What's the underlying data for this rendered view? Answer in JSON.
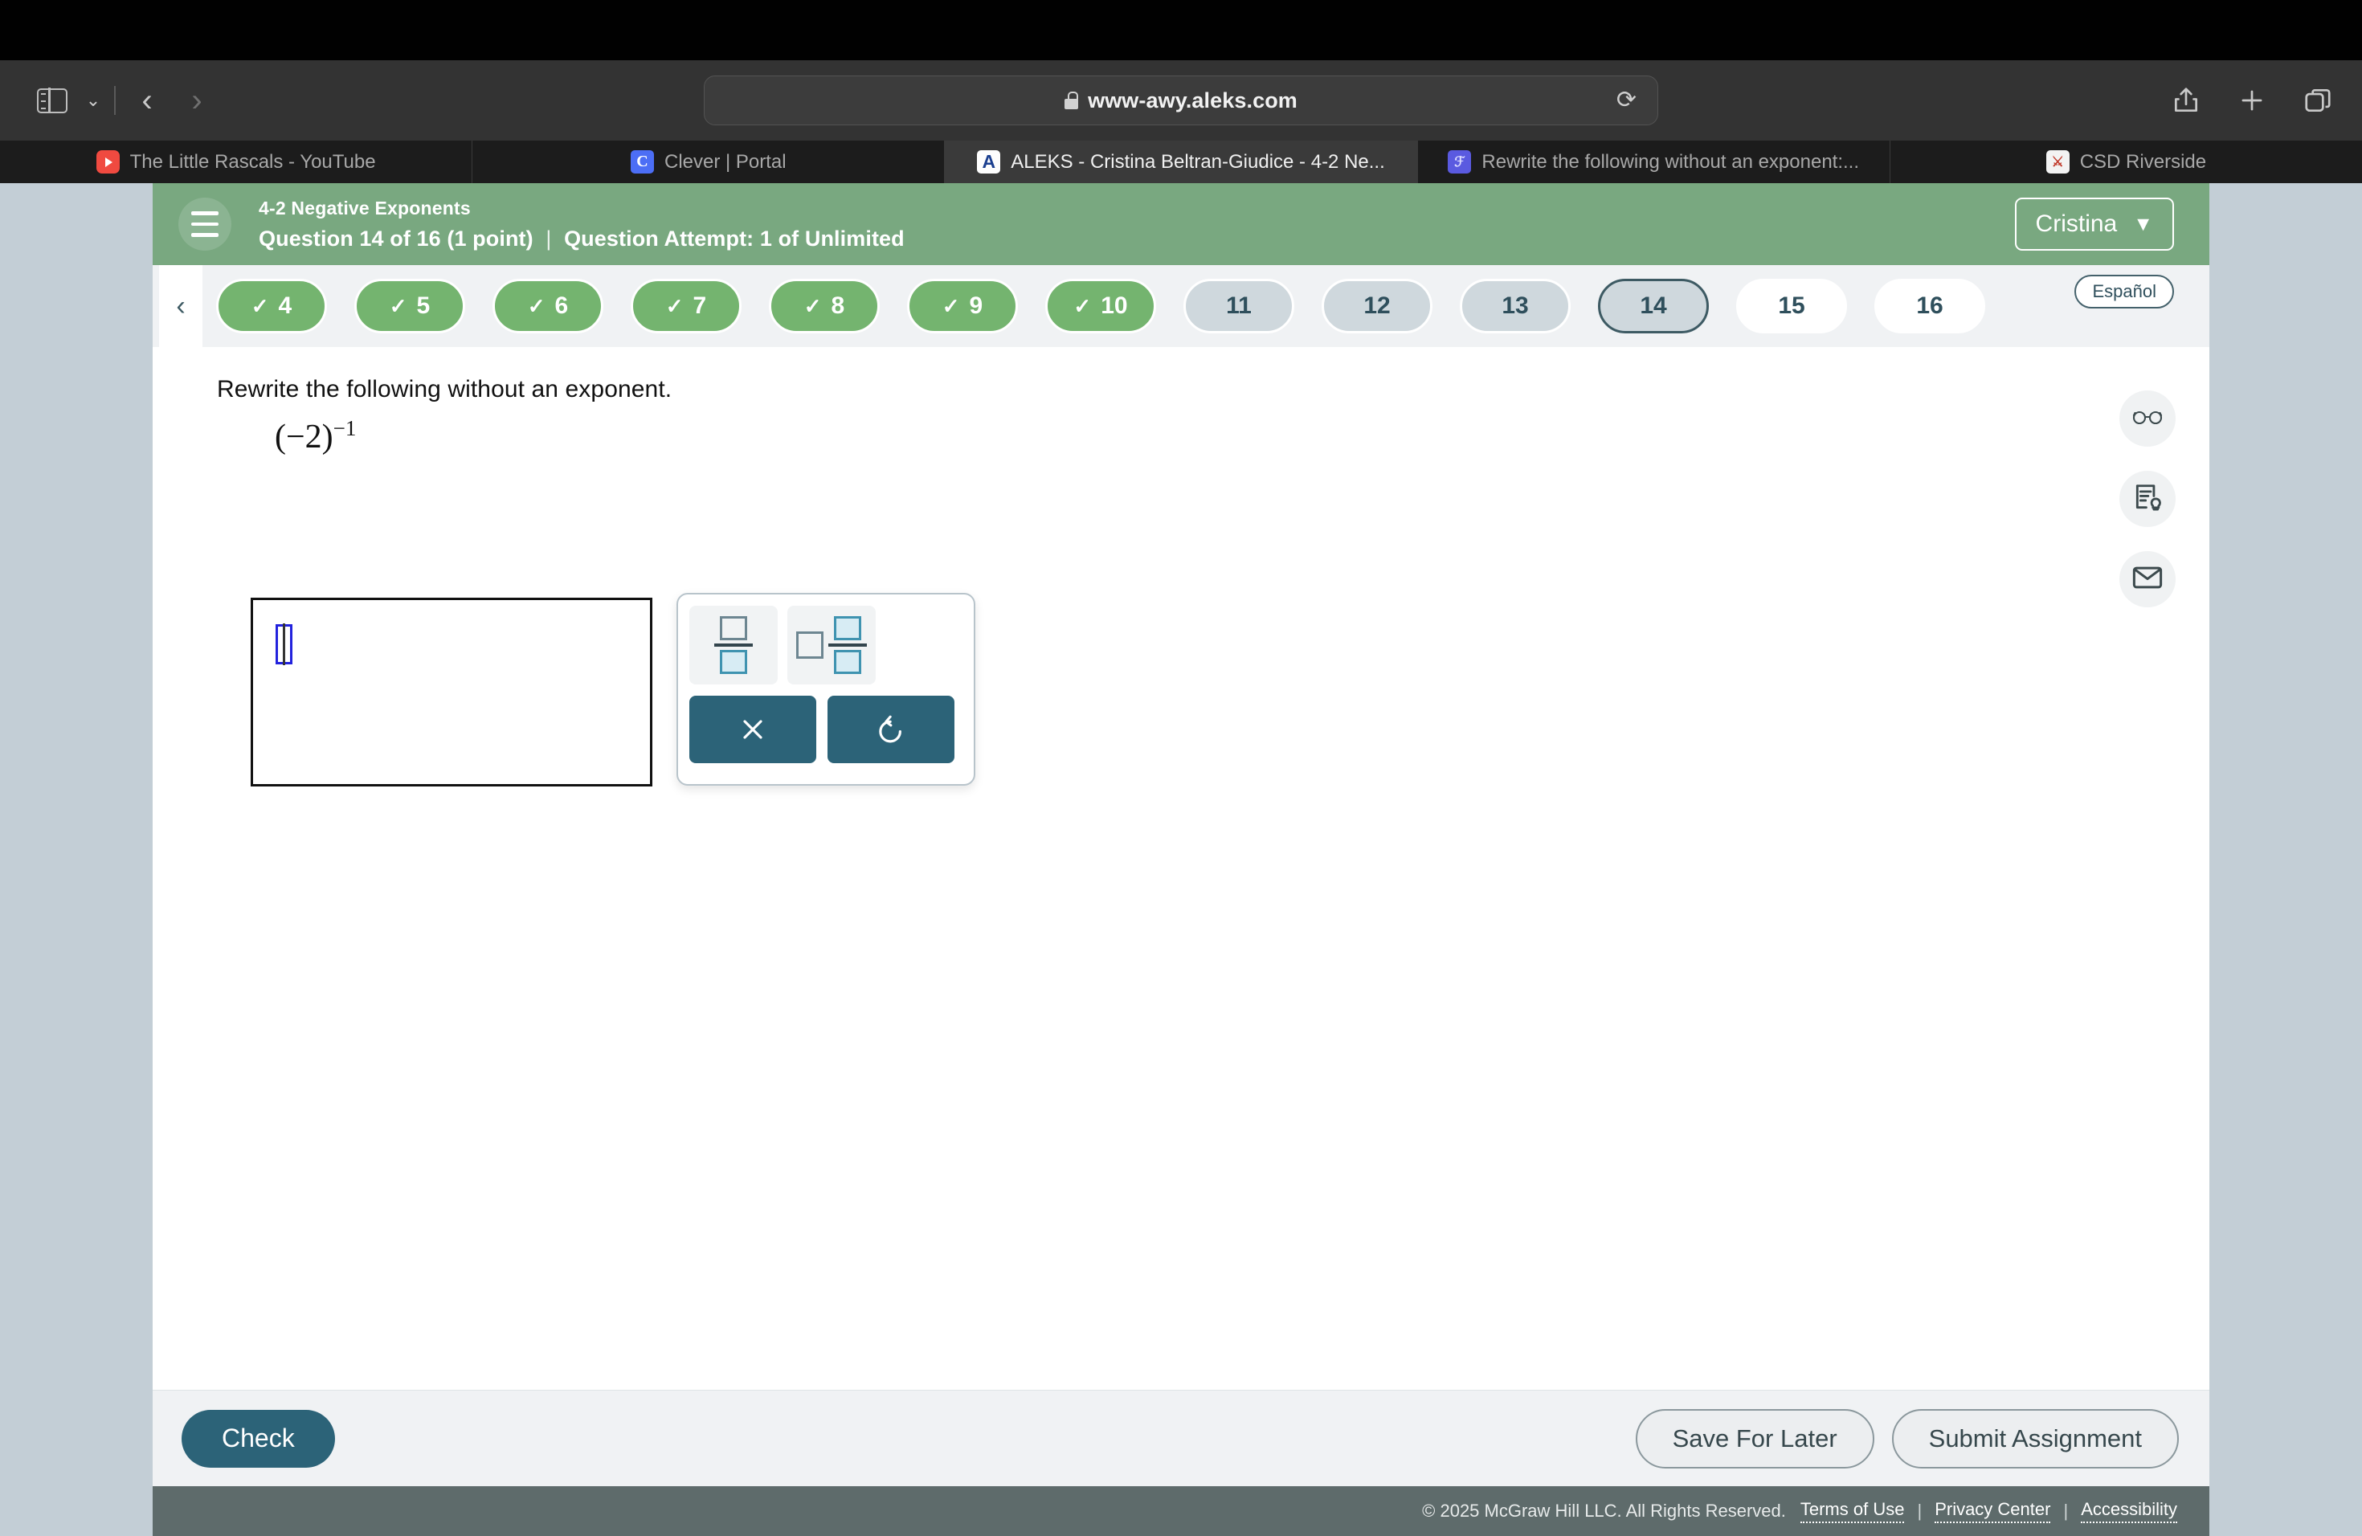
{
  "browser": {
    "url": "www-awy.aleks.com",
    "url_secure_icon": "lock-icon",
    "reload_icon": "reload-icon",
    "sidebar_icon": "sidebar-toggle-icon",
    "back_icon": "back-chevron-icon",
    "forward_icon": "forward-chevron-icon",
    "share_icon": "share-icon",
    "new_tab_icon": "plus-icon",
    "tabs_overview_icon": "tab-overview-icon",
    "tabs": [
      {
        "title": "The Little Rascals - YouTube",
        "favicon": "youtube-icon",
        "favicon_letter": "",
        "active": false
      },
      {
        "title": "Clever | Portal",
        "favicon": "clever-icon",
        "favicon_letter": "C",
        "active": false
      },
      {
        "title": "ALEKS - Cristina Beltran-Giudice - 4-2 Ne...",
        "favicon": "aleks-icon",
        "favicon_letter": "A",
        "active": true
      },
      {
        "title": "Rewrite the following without an exponent:...",
        "favicon": "doc-icon",
        "favicon_letter": "ℱ",
        "active": false
      },
      {
        "title": "CSD Riverside",
        "favicon": "csd-riverside-icon",
        "favicon_letter": "⚔",
        "active": false
      }
    ]
  },
  "header": {
    "menu_icon": "hamburger-menu-icon",
    "assignment_title": "4-2 Negative Exponents",
    "question_counter": "Question 14 of 16 (1 point)",
    "separator": "|",
    "attempt_text": "Question Attempt: 1 of Unlimited",
    "user_name": "Cristina",
    "user_caret_icon": "chevron-down-icon",
    "brand_green": "#79a880"
  },
  "qnav": {
    "back_icon": "chevron-left-icon",
    "espanol_label": "Español",
    "check_glyph": "✓",
    "items": [
      {
        "number": "4",
        "state": "done"
      },
      {
        "number": "5",
        "state": "done"
      },
      {
        "number": "6",
        "state": "done"
      },
      {
        "number": "7",
        "state": "done"
      },
      {
        "number": "8",
        "state": "done"
      },
      {
        "number": "9",
        "state": "done"
      },
      {
        "number": "10",
        "state": "done"
      },
      {
        "number": "11",
        "state": "pending"
      },
      {
        "number": "12",
        "state": "pending"
      },
      {
        "number": "13",
        "state": "pending"
      },
      {
        "number": "14",
        "state": "current"
      },
      {
        "number": "15",
        "state": "future"
      },
      {
        "number": "16",
        "state": "future"
      }
    ],
    "colors": {
      "done": "#74b46f",
      "pending": "#cfd8dd",
      "current_border": "#3d5a63",
      "future": "#ffffff"
    }
  },
  "question": {
    "prompt": "Rewrite the following without an exponent.",
    "expression_base": "(−2)",
    "expression_exponent": "−1",
    "answer_value": "",
    "answer_placeholder": ""
  },
  "keypad": {
    "fraction_template_icon": "fraction-template-icon",
    "mixed_number_template_icon": "mixed-number-template-icon",
    "clear_icon": "clear-x-icon",
    "undo_icon": "undo-icon",
    "accent_color": "#2c6378"
  },
  "right_rail": [
    {
      "icon": "glasses-icon",
      "name": "read-aloud-button"
    },
    {
      "icon": "notes-lightbulb-icon",
      "name": "explanation-button"
    },
    {
      "icon": "envelope-icon",
      "name": "message-button"
    }
  ],
  "actions": {
    "check_label": "Check",
    "save_for_later_label": "Save For Later",
    "submit_assignment_label": "Submit Assignment"
  },
  "footer": {
    "copyright": "© 2025 McGraw Hill LLC. All Rights Reserved.",
    "terms_label": "Terms of Use",
    "privacy_label": "Privacy Center",
    "accessibility_label": "Accessibility",
    "separator": "|"
  }
}
